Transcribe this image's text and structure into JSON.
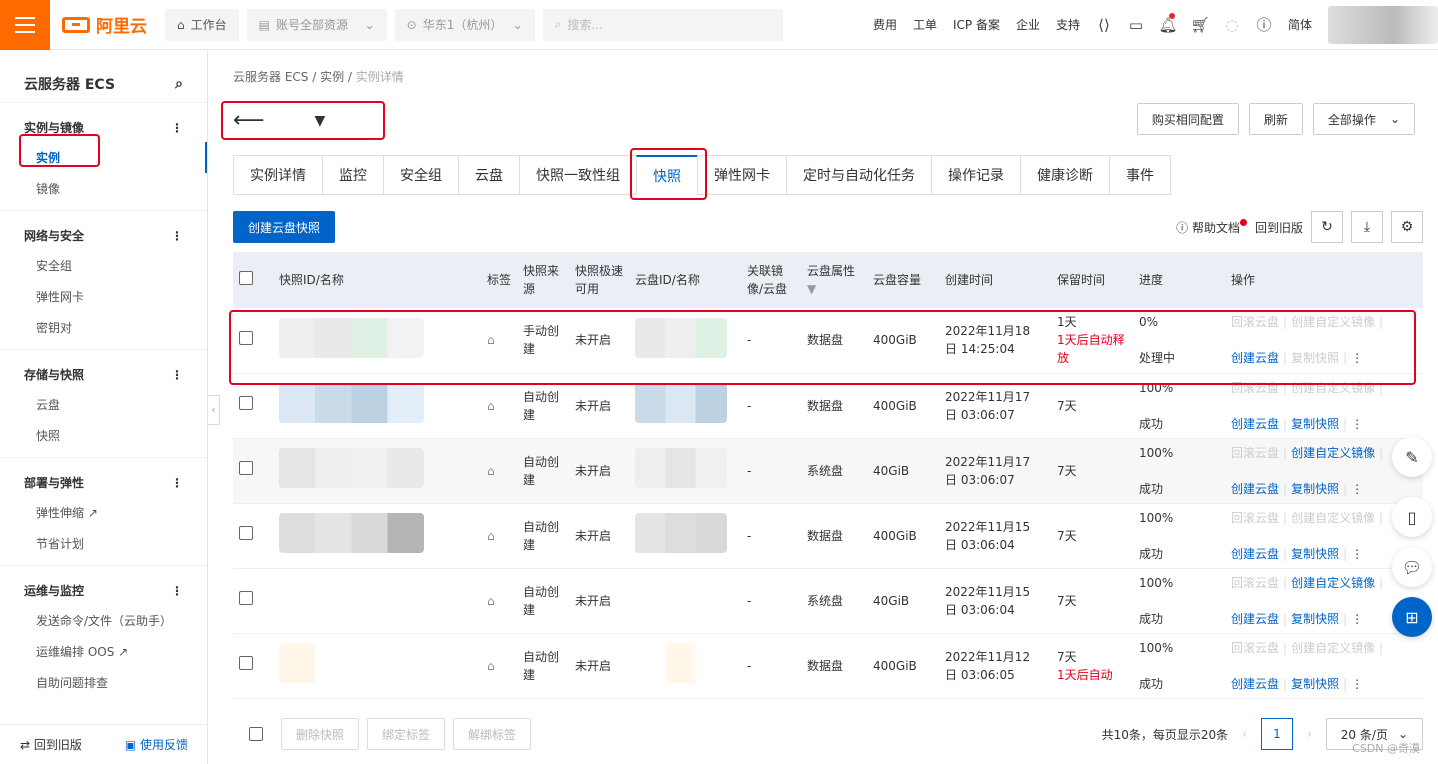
{
  "topbar": {
    "logo_text": "阿里云",
    "workbench": "工作台",
    "account_scope": "账号全部资源",
    "region": "华东1（杭州）",
    "search_placeholder": "搜索...",
    "links": [
      "费用",
      "工单",
      "ICP 备案",
      "企业",
      "支持"
    ],
    "lang": "简体"
  },
  "sidebar": {
    "title": "云服务器 ECS",
    "groups": [
      {
        "label": "实例与镜像",
        "items": [
          "实例",
          "镜像"
        ]
      },
      {
        "label": "网络与安全",
        "items": [
          "安全组",
          "弹性网卡",
          "密钥对"
        ]
      },
      {
        "label": "存储与快照",
        "items": [
          "云盘",
          "快照"
        ]
      },
      {
        "label": "部署与弹性",
        "items": [
          "弹性伸缩",
          "节省计划"
        ]
      },
      {
        "label": "运维与监控",
        "items": [
          "发送命令/文件（云助手）",
          "运维编排 OOS",
          "自助问题排查"
        ]
      }
    ],
    "footer_back": "回到旧版",
    "footer_feedback": "使用反馈"
  },
  "breadcrumb": [
    "云服务器 ECS",
    "实例",
    "实例详情"
  ],
  "header_buttons": {
    "buy_same": "购买相同配置",
    "refresh": "刷新",
    "all_ops": "全部操作"
  },
  "tabs": [
    "实例详情",
    "监控",
    "安全组",
    "云盘",
    "快照一致性组",
    "快照",
    "弹性网卡",
    "定时与自动化任务",
    "操作记录",
    "健康诊断",
    "事件"
  ],
  "toolbar": {
    "create_snapshot": "创建云盘快照",
    "help_doc": "帮助文档",
    "back_old": "回到旧版"
  },
  "table": {
    "headers": [
      "快照ID/名称",
      "标签",
      "快照来源",
      "快照极速可用",
      "云盘ID/名称",
      "关联镜像/云盘",
      "云盘属性",
      "云盘容量",
      "创建时间",
      "保留时间",
      "进度",
      "操作"
    ],
    "rows": [
      {
        "source": "手动创建",
        "fast": "未开启",
        "link": "-",
        "attr": "数据盘",
        "cap": "400GiB",
        "time1": "2022年11月18",
        "time2": "日 14:25:04",
        "keep": "1天",
        "keep_note": "1天后自动释放",
        "progress": "0%",
        "status": "处理中",
        "op_rollback": "回滚云盘",
        "op_custom": "创建自定义镜像",
        "op_create": "创建云盘",
        "op_copy": "复制快照"
      },
      {
        "source": "自动创建",
        "fast": "未开启",
        "link": "-",
        "attr": "数据盘",
        "cap": "400GiB",
        "time1": "2022年11月17",
        "time2": "日 03:06:07",
        "keep": "7天",
        "keep_note": "",
        "progress": "100%",
        "status": "成功",
        "op_rollback": "回滚云盘",
        "op_custom": "创建自定义镜像",
        "op_create": "创建云盘",
        "op_copy": "复制快照"
      },
      {
        "source": "自动创建",
        "fast": "未开启",
        "link": "-",
        "attr": "系统盘",
        "cap": "40GiB",
        "time1": "2022年11月17",
        "time2": "日 03:06:07",
        "keep": "7天",
        "keep_note": "",
        "progress": "100%",
        "status": "成功",
        "op_rollback": "回滚云盘",
        "op_custom": "创建自定义镜像",
        "op_create": "创建云盘",
        "op_copy": "复制快照"
      },
      {
        "source": "自动创建",
        "fast": "未开启",
        "link": "-",
        "attr": "数据盘",
        "cap": "400GiB",
        "time1": "2022年11月15",
        "time2": "日 03:06:04",
        "keep": "7天",
        "keep_note": "",
        "progress": "100%",
        "status": "成功",
        "op_rollback": "回滚云盘",
        "op_custom": "创建自定义镜像",
        "op_create": "创建云盘",
        "op_copy": "复制快照"
      },
      {
        "source": "自动创建",
        "fast": "未开启",
        "link": "-",
        "attr": "系统盘",
        "cap": "40GiB",
        "time1": "2022年11月15",
        "time2": "日 03:06:04",
        "keep": "7天",
        "keep_note": "",
        "progress": "100%",
        "status": "成功",
        "op_rollback": "回滚云盘",
        "op_custom": "创建自定义镜像",
        "op_create": "创建云盘",
        "op_copy": "复制快照"
      },
      {
        "source": "自动创建",
        "fast": "未开启",
        "link": "-",
        "attr": "数据盘",
        "cap": "400GiB",
        "time1": "2022年11月12",
        "time2": "日 03:06:05",
        "keep": "7天",
        "keep_note": "1天后自动",
        "progress": "100%",
        "status": "成功",
        "op_rollback": "回滚云盘",
        "op_custom": "创建自定义镜像",
        "op_create": "创建云盘",
        "op_copy": "复制快照"
      }
    ]
  },
  "footer": {
    "delete": "删除快照",
    "bind_tag": "绑定标签",
    "unbind_tag": "解绑标签",
    "summary": "共10条，每页显示20条",
    "page": "1",
    "page_size": "20 条/页"
  },
  "watermark": "CSDN @奇漠"
}
